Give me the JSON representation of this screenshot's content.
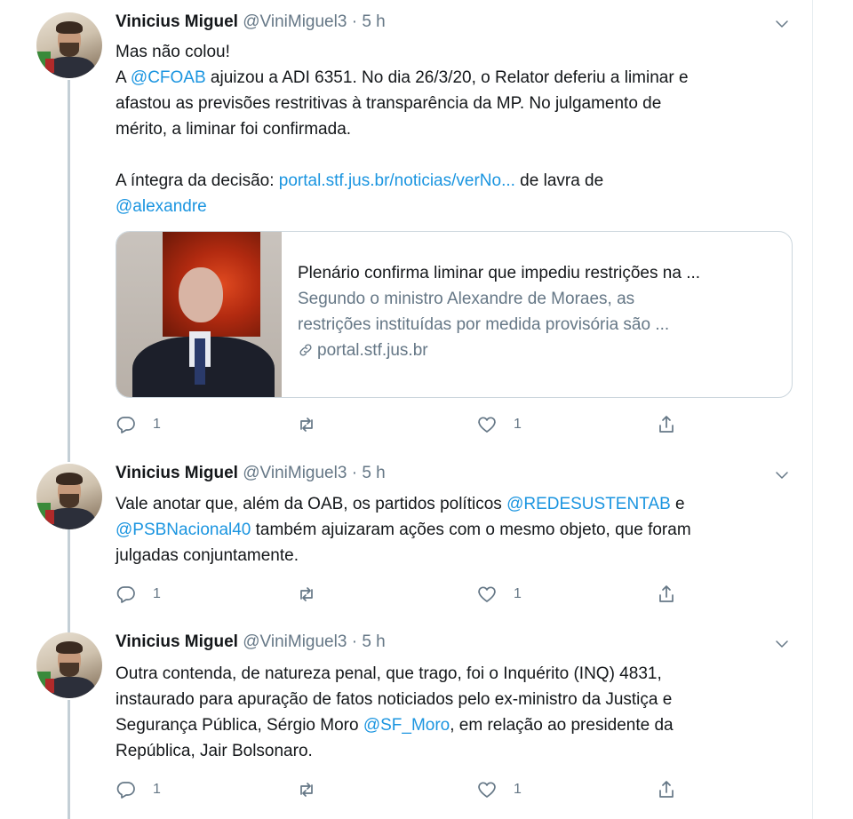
{
  "tweets": [
    {
      "author": "Vinicius Miguel",
      "handle": "@ViniMiguel3",
      "dot": "·",
      "time": "5 h",
      "body": [
        [
          {
            "t": "Mas não colou!"
          }
        ],
        [
          {
            "t": "A "
          },
          {
            "t": "@CFOAB",
            "link": true
          },
          {
            "t": " ajuizou a ADI 6351. No dia 26/3/20, o Relator deferiu a liminar e"
          }
        ],
        [
          {
            "t": "afastou as previsões restritivas à transparência da MP. No julgamento de"
          }
        ],
        [
          {
            "t": "mérito, a liminar foi confirmada."
          }
        ],
        [
          {
            "t": ""
          }
        ],
        [
          {
            "t": "A íntegra da decisão: "
          },
          {
            "t": "portal.stf.jus.br/noticias/verNo...",
            "link": true
          },
          {
            "t": " de lavra de"
          }
        ],
        [
          {
            "t": "@alexandre",
            "link": true
          }
        ]
      ],
      "card": {
        "title": "Plenário confirma liminar que impediu restrições na ...",
        "desc1": "Segundo o ministro Alexandre de Moraes, as",
        "desc2": "restrições instituídas por medida provisória são ...",
        "domain": "portal.stf.jus.br"
      },
      "replies": "1",
      "retweets": "",
      "likes": "1"
    },
    {
      "author": "Vinicius Miguel",
      "handle": "@ViniMiguel3",
      "dot": "·",
      "time": "5 h",
      "body": [
        [
          {
            "t": "Vale anotar que, além da OAB, os partidos políticos "
          },
          {
            "t": "@REDESUSTENTAB",
            "link": true
          },
          {
            "t": " e"
          }
        ],
        [
          {
            "t": "@PSBNacional40",
            "link": true
          },
          {
            "t": " também ajuizaram ações com o mesmo objeto, que foram"
          }
        ],
        [
          {
            "t": "julgadas conjuntamente."
          }
        ]
      ],
      "replies": "1",
      "retweets": "",
      "likes": "1"
    },
    {
      "author": "Vinicius Miguel",
      "handle": "@ViniMiguel3",
      "dot": "·",
      "time": "5 h",
      "body": [
        [
          {
            "t": "Outra contenda, de natureza penal, que trago, foi o Inquérito (INQ) 4831,"
          }
        ],
        [
          {
            "t": "instaurado para apuração de fatos noticiados pelo ex-ministro da Justiça e"
          }
        ],
        [
          {
            "t": "Segurança Pública, Sérgio Moro "
          },
          {
            "t": "@SF_Moro",
            "link": true
          },
          {
            "t": ", em relação ao presidente da"
          }
        ],
        [
          {
            "t": "República, Jair Bolsonaro."
          }
        ]
      ],
      "replies": "1",
      "retweets": "",
      "likes": "1"
    }
  ],
  "icons": {
    "reply": "reply-icon",
    "retweet": "retweet-icon",
    "like": "heart-icon",
    "share": "share-icon",
    "caret": "chevron-down-icon",
    "link": "link-icon"
  },
  "colors": {
    "link": "#1b95e0",
    "secondary": "#657786",
    "thread_line": "#c4cfd6"
  }
}
